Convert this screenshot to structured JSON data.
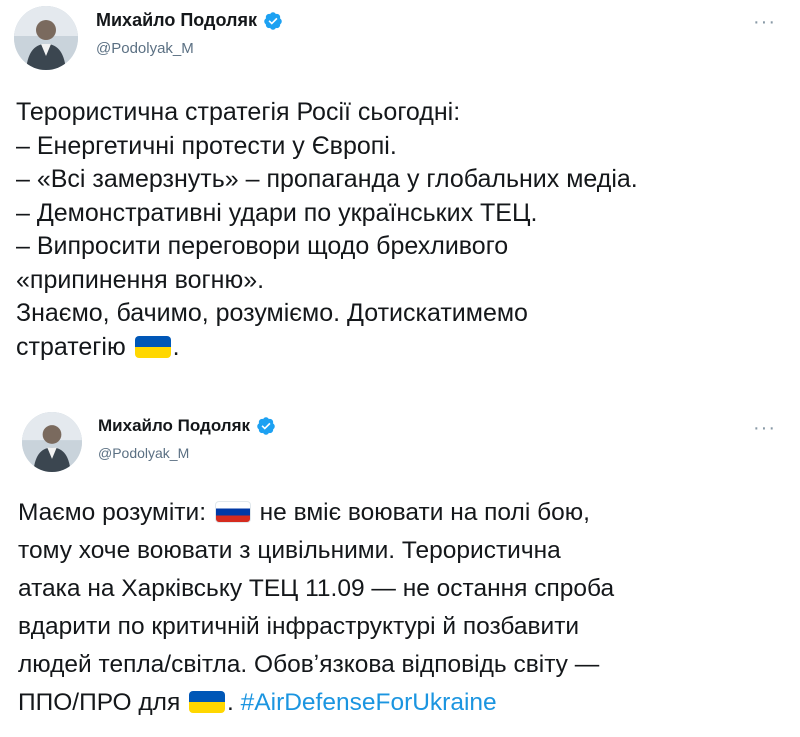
{
  "tweets": [
    {
      "author_name": "Михайло Подоляк",
      "author_handle": "@Podolyak_M",
      "avatar_icon": "person-avatar",
      "verified_icon": "verified-badge-icon",
      "more_icon": "more-options-icon",
      "lines": [
        "Терористична стратегія Росії сьогодні:",
        "– Енергетичні протести у Європі.",
        "– «Всі замерзнуть» – пропаганда у глобальних медіа.",
        "– Демонстративні удари по українських ТЕЦ.",
        "– Випросити переговори щодо брехливого",
        "«припинення вогню».",
        "Знаємо, бачимо, розуміємо. Дотискатимемо",
        "стратегію",
        "."
      ]
    },
    {
      "author_name": "Михайло Подоляк",
      "author_handle": "@Podolyak_M",
      "avatar_icon": "person-avatar",
      "verified_icon": "verified-badge-icon",
      "more_icon": "more-options-icon",
      "line1_a": "Маємо розуміти:",
      "line1_b": "не вміє воювати на полі бою,",
      "lines": [
        "тому хоче воювати з цивільними. Терористична",
        "атака на Харківську ТЕЦ 11.09 — не остання спроба",
        "вдарити по критичній інфраструктурі й позбавити",
        "людей тепла/світла. Обовʼязкова відповідь світу —"
      ],
      "line6_a": "ППО/ПРО для",
      "line6_b": ".",
      "hashtag": "#AirDefenseForUkraine"
    }
  ],
  "colors": {
    "text": "#14171a",
    "secondary": "#5b7083",
    "link": "#1b95e0",
    "verified": "#1da1f2",
    "ua_blue": "#0057b7",
    "ua_yellow": "#ffd700"
  },
  "icons": {
    "ua_flag": "flag-ukraine-icon",
    "ru_flag": "flag-russia-icon"
  }
}
